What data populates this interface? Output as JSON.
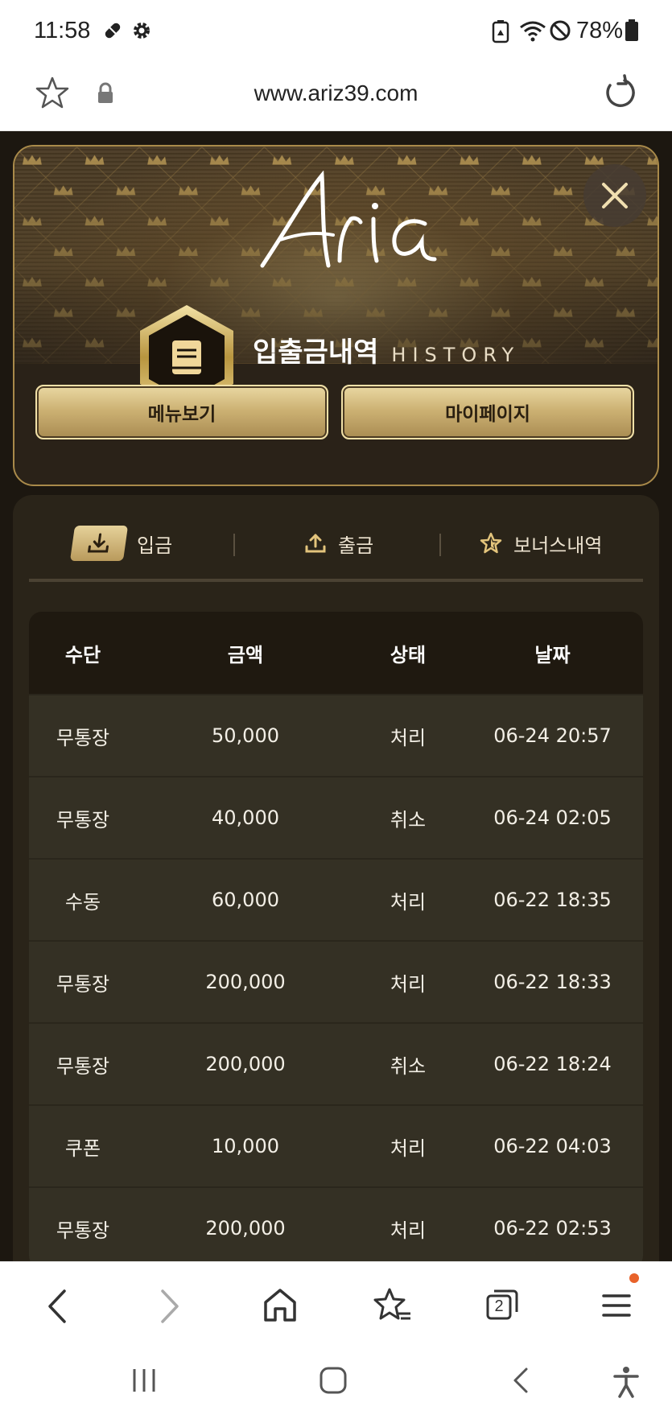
{
  "status_bar": {
    "time": "11:58",
    "battery": "78%"
  },
  "browser": {
    "url": "www.ariz39.com",
    "tab_count": "2"
  },
  "header": {
    "logo_text": "Aria",
    "title": "입출금내역",
    "subtitle": "HISTORY",
    "menu_button": "메뉴보기",
    "mypage_button": "마이페이지"
  },
  "tabs": [
    {
      "label": "입금",
      "icon": "download-icon",
      "active": true
    },
    {
      "label": "출금",
      "icon": "upload-icon",
      "active": false
    },
    {
      "label": "보너스내역",
      "icon": "star-icon",
      "active": false
    }
  ],
  "table": {
    "columns": [
      "수단",
      "금액",
      "상태",
      "날짜"
    ],
    "rows": [
      [
        "무통장",
        "50,000",
        "처리",
        "06-24 20:57"
      ],
      [
        "무통장",
        "40,000",
        "취소",
        "06-24 02:05"
      ],
      [
        "수동",
        "60,000",
        "처리",
        "06-22 18:35"
      ],
      [
        "무통장",
        "200,000",
        "처리",
        "06-22 18:33"
      ],
      [
        "무통장",
        "200,000",
        "취소",
        "06-22 18:24"
      ],
      [
        "쿠폰",
        "10,000",
        "처리",
        "06-22 04:03"
      ],
      [
        "무통장",
        "200,000",
        "처리",
        "06-22 02:53"
      ]
    ]
  },
  "colors": {
    "gold": "#cdb274",
    "page_bg": "#1c1710",
    "row_bg": "#343024",
    "header_bg": "#1f1910",
    "notification_dot": "#e8622a"
  }
}
